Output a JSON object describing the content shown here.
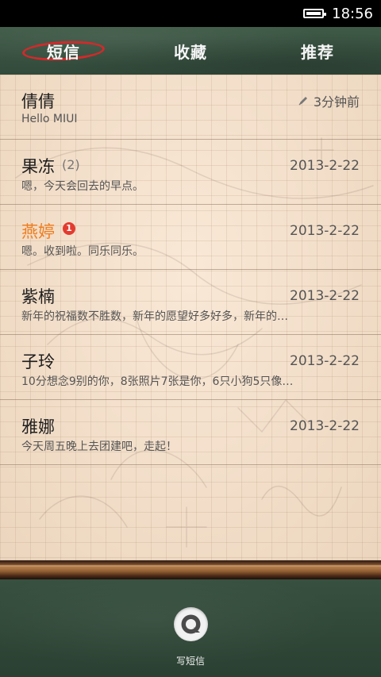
{
  "status_bar": {
    "time": "18:56",
    "battery_icon": "battery-icon"
  },
  "tabs": [
    {
      "label": "短信",
      "active": true
    },
    {
      "label": "收藏",
      "active": false
    },
    {
      "label": "推荐",
      "active": false
    }
  ],
  "messages": [
    {
      "name": "倩倩",
      "time": "3分钟前",
      "time_icon": "pencil-icon",
      "preview": "Hello MIUI",
      "unread": false
    },
    {
      "name": "果冻",
      "count": "(2)",
      "time": "2013-2-22",
      "preview": "嗯，今天会回去的早点。",
      "unread": false
    },
    {
      "name": "燕婷",
      "badge": "1",
      "time": "2013-2-22",
      "preview": "嗯。收到啦。同乐同乐。",
      "unread": true
    },
    {
      "name": "紫楠",
      "time": "2013-2-22",
      "preview": "新年的祝福数不胜数，新年的愿望好多好多，新年的…",
      "unread": false
    },
    {
      "name": "子玲",
      "time": "2013-2-22",
      "preview": "10分想念9别的你，8张照片7张是你，6只小狗5只像…",
      "unread": false
    },
    {
      "name": "雅娜",
      "time": "2013-2-22",
      "preview": "今天周五晚上去团建吧，走起！",
      "unread": false
    }
  ],
  "compose": {
    "label": "写短信",
    "icon": "compose-message-icon"
  },
  "colors": {
    "unread_name": "#f07d1e",
    "badge": "#e33b2f",
    "active_tab_marker": "#d3292a",
    "board": "#324a3b",
    "paper": "#f1ddc7"
  }
}
